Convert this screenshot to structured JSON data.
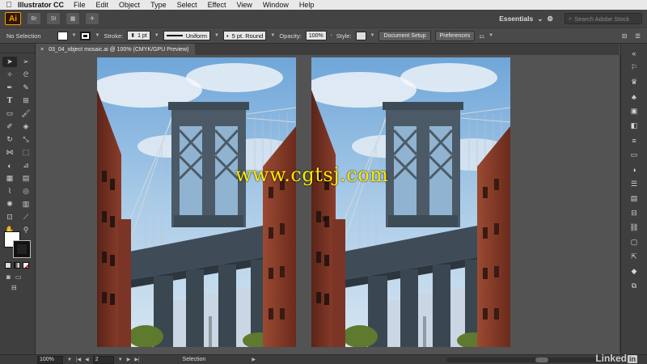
{
  "menubar": {
    "apple": "",
    "app_name": "Illustrator CC",
    "items": [
      "File",
      "Edit",
      "Object",
      "Type",
      "Select",
      "Effect",
      "View",
      "Window",
      "Help"
    ]
  },
  "appbar": {
    "logo": "Ai",
    "br": "Br",
    "st": "St",
    "workspace": "Essentials",
    "search_placeholder": "Search Adobe Stock"
  },
  "control": {
    "selection": "No Selection",
    "stroke_label": "Stroke:",
    "stroke_weight": "1 pt",
    "stroke_profile": "Uniform",
    "brush": "5 pt. Round",
    "opacity_label": "Opacity:",
    "opacity": "100%",
    "style_label": "Style:",
    "document_setup": "Document Setup",
    "preferences": "Preferences"
  },
  "document": {
    "tab_title": "03_04_object mosaic.ai @ 100% (CMYK/GPU Preview)",
    "close": "×"
  },
  "watermark": "www.cgtsj.com",
  "status": {
    "zoom": "100%",
    "page": "2",
    "tool_name": "Selection"
  },
  "branding": {
    "linkedin": "Linked",
    "in": "in"
  },
  "colors": {
    "accent": "#ff9a00",
    "panel": "#3f3f3f",
    "canvas": "#535353"
  }
}
